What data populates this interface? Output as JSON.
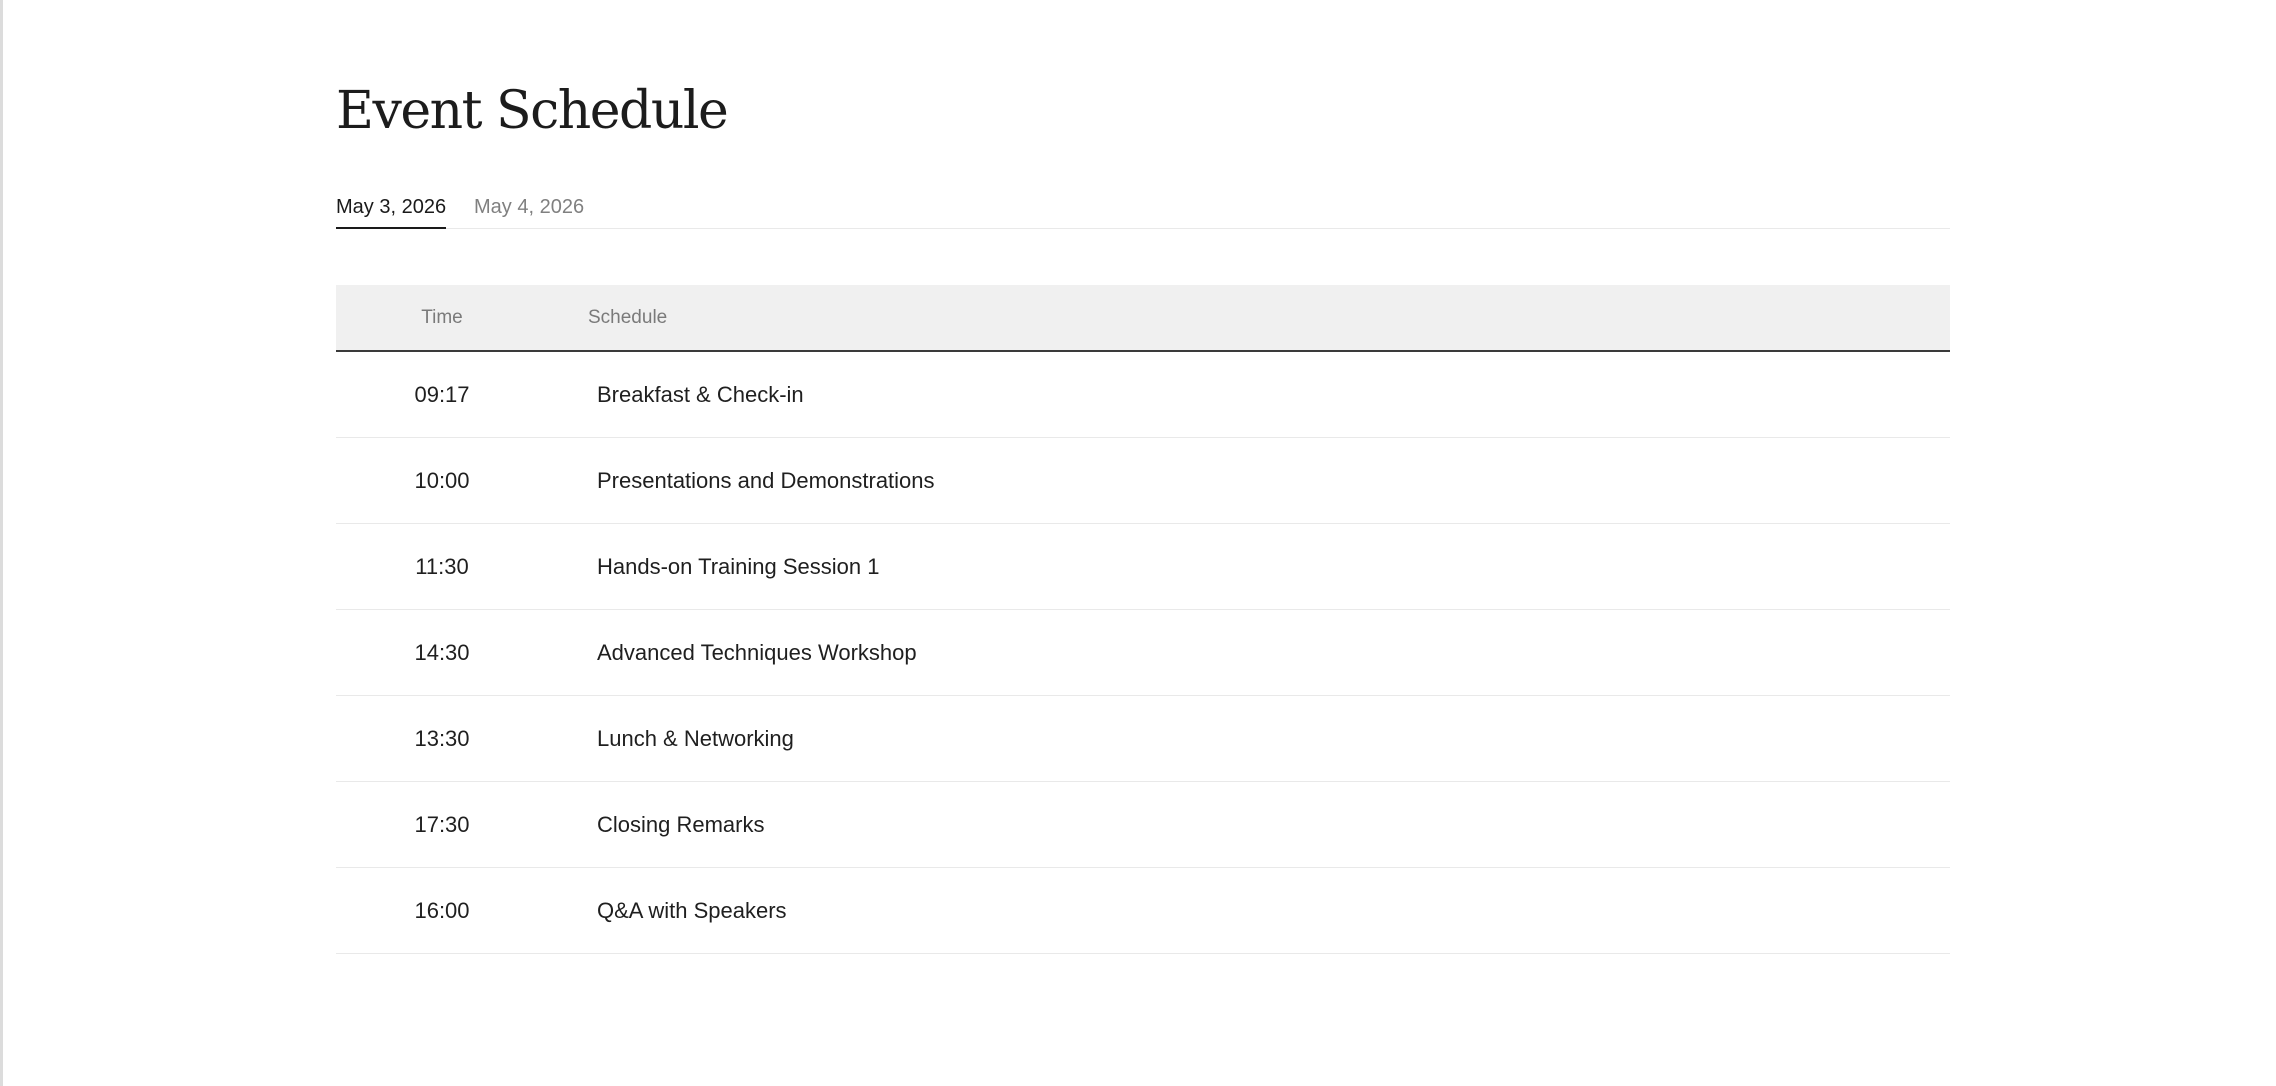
{
  "page": {
    "title": "Event Schedule"
  },
  "tabs": [
    {
      "label": "May 3, 2026",
      "active": true
    },
    {
      "label": "May 4, 2026",
      "active": false
    }
  ],
  "table": {
    "headers": {
      "time": "Time",
      "schedule": "Schedule"
    },
    "rows": [
      {
        "time": "09:17",
        "event": "Breakfast & Check-in"
      },
      {
        "time": "10:00",
        "event": "Presentations and Demonstrations"
      },
      {
        "time": "11:30",
        "event": "Hands-on Training Session 1"
      },
      {
        "time": "14:30",
        "event": "Advanced Techniques Workshop"
      },
      {
        "time": "13:30",
        "event": "Lunch & Networking"
      },
      {
        "time": "17:30",
        "event": "Closing Remarks"
      },
      {
        "time": "16:00",
        "event": "Q&A with Speakers"
      }
    ]
  },
  "colors": {
    "text": "#1f1f1f",
    "muted": "#808080",
    "header_bg": "#f0f0f0",
    "divider": "#e9e9e9",
    "active_underline": "#1a1a1a"
  }
}
